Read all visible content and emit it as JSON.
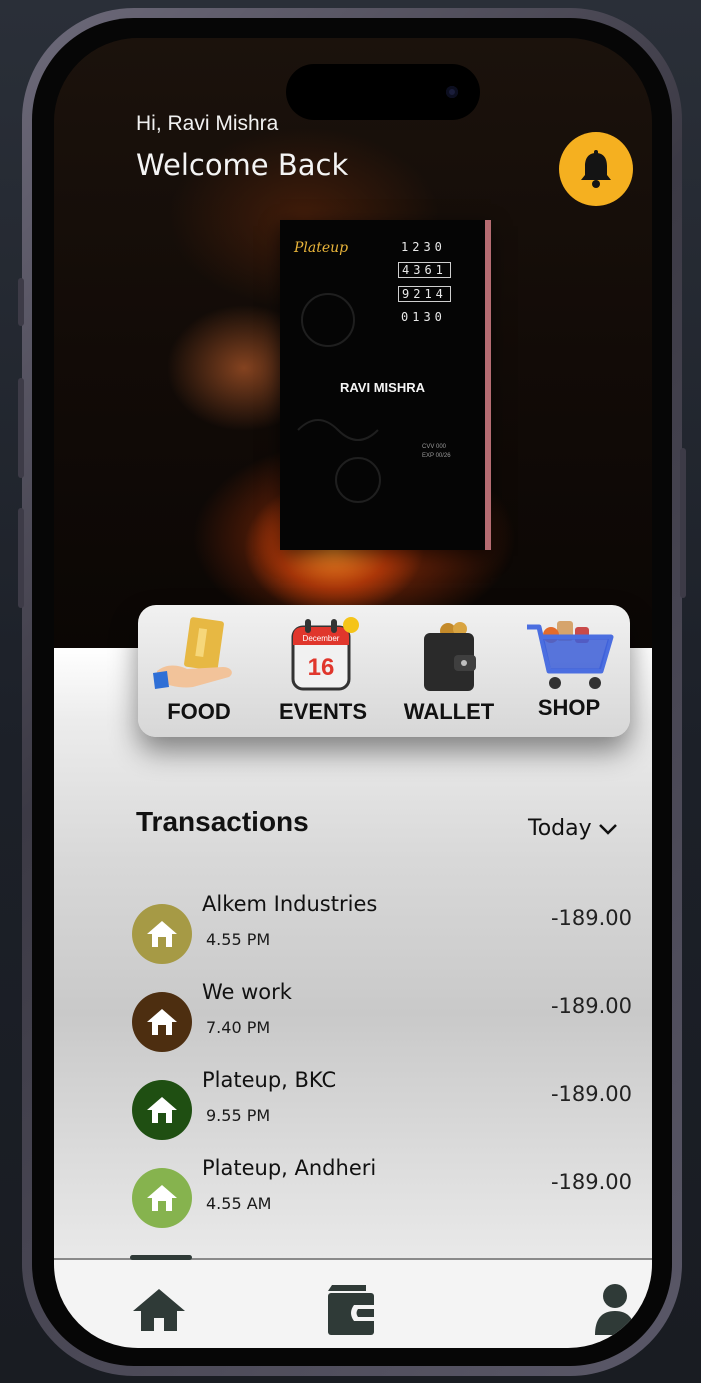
{
  "header": {
    "greeting": "Hi, Ravi Mishra",
    "welcome": "Welcome Back",
    "notification_icon": "bell-icon"
  },
  "card": {
    "brand": "Plateup",
    "numbers": [
      "1230",
      "4361",
      "9214",
      "0130"
    ],
    "holder": "RAVI MISHRA",
    "cvv": "CVV 000",
    "expiry": "EXP 00/26"
  },
  "categories": [
    {
      "label": "FOOD",
      "icon": "food-card-hand-icon"
    },
    {
      "label": "EVENTS",
      "icon": "calendar-icon",
      "calendar_month": "December",
      "calendar_day": "16"
    },
    {
      "label": "WALLET",
      "icon": "wallet-icon"
    },
    {
      "label": "SHOP",
      "icon": "shopping-cart-icon"
    }
  ],
  "transactions": {
    "title": "Transactions",
    "filter": "Today",
    "items": [
      {
        "name": "Alkem Industries",
        "time": "4.55 PM",
        "amount": "-189.00",
        "color": "#a69a45"
      },
      {
        "name": "We work",
        "time": "7.40 PM",
        "amount": "-189.00",
        "color": "#4d2e10"
      },
      {
        "name": "Plateup, BKC",
        "time": "9.55 PM",
        "amount": "-189.00",
        "color": "#1f4f12"
      },
      {
        "name": "Plateup, Andheri",
        "time": "4.55 AM",
        "amount": "-189.00",
        "color": "#86b34e"
      }
    ]
  },
  "tabbar": {
    "items": [
      {
        "icon": "home-icon",
        "active": true
      },
      {
        "icon": "wallet-icon",
        "active": false
      },
      {
        "icon": "profile-icon",
        "active": false
      }
    ]
  },
  "colors": {
    "accent": "#f5b020",
    "tab_icon": "#2f3a37"
  }
}
